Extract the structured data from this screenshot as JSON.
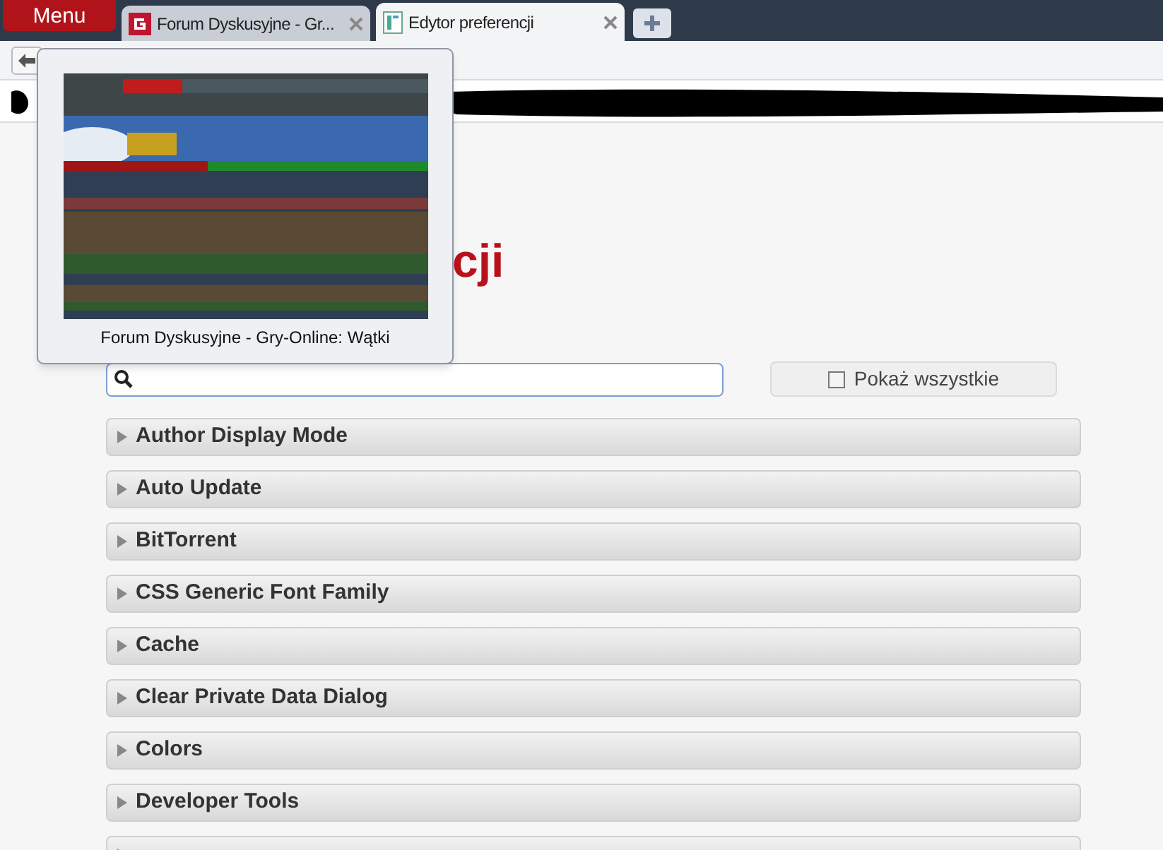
{
  "menu_button": {
    "label": "Menu"
  },
  "tabs": [
    {
      "title": "Forum Dyskusyjne - Gr...",
      "kind": "site",
      "selected": false
    },
    {
      "title": "Edytor preferencji",
      "kind": "document",
      "selected": true
    }
  ],
  "tab_preview": {
    "caption": "Forum Dyskusyjne - Gry-Online: Wątki"
  },
  "page": {
    "heading": "cji",
    "show_all": {
      "label": "Pokaż wszystkie",
      "checked": false
    },
    "sections": [
      {
        "title": "Author Display Mode",
        "expanded": false
      },
      {
        "title": "Auto Update",
        "expanded": false
      },
      {
        "title": "BitTorrent",
        "expanded": false
      },
      {
        "title": "CSS Generic Font Family",
        "expanded": false
      },
      {
        "title": "Cache",
        "expanded": false
      },
      {
        "title": "Clear Private Data Dialog",
        "expanded": false
      },
      {
        "title": "Colors",
        "expanded": false
      },
      {
        "title": "Developer Tools",
        "expanded": false
      },
      {
        "expanded": false
      }
    ]
  }
}
